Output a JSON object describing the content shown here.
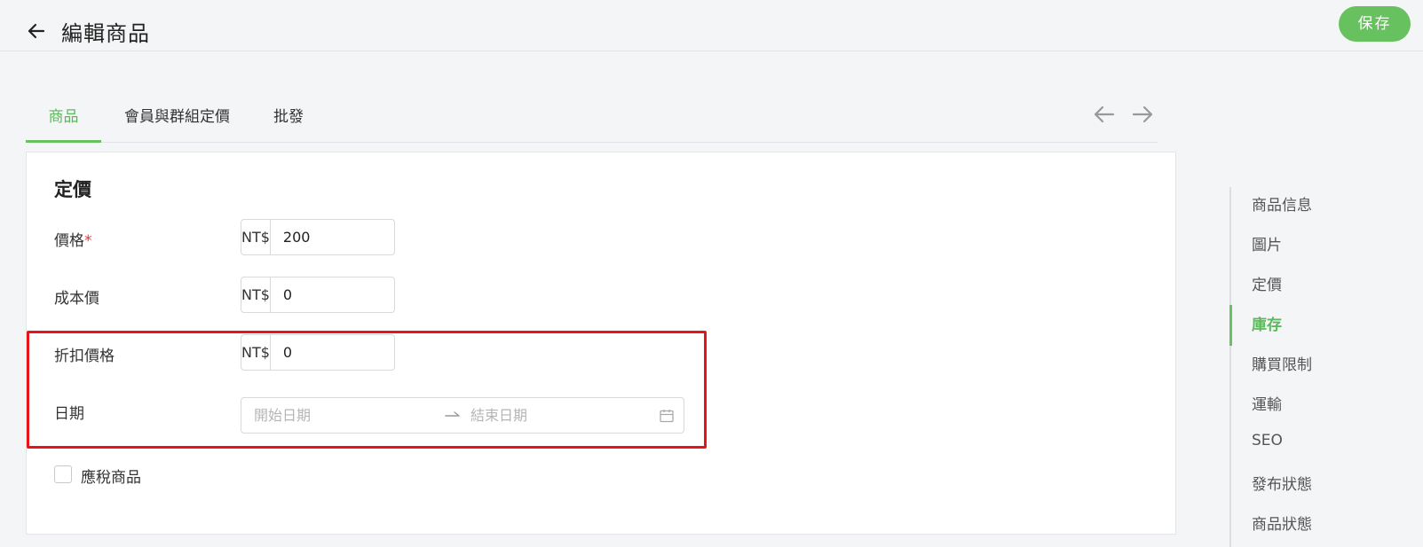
{
  "header": {
    "title": "編輯商品",
    "save_label": "保存"
  },
  "tabs": [
    {
      "label": "商品",
      "active": true
    },
    {
      "label": "會員與群組定價",
      "active": false
    },
    {
      "label": "批發",
      "active": false
    }
  ],
  "pricing": {
    "section_title": "定價",
    "price": {
      "label": "價格",
      "required_mark": "*",
      "currency": "NT$",
      "value": "200"
    },
    "cost": {
      "label": "成本價",
      "currency": "NT$",
      "value": "0"
    },
    "discount": {
      "label": "折扣價格",
      "currency": "NT$",
      "value": "0"
    },
    "date": {
      "label": "日期",
      "start_placeholder": "開始日期",
      "end_placeholder": "結束日期"
    },
    "taxable": {
      "label": "應稅商品",
      "checked": false
    }
  },
  "side_nav": {
    "items": [
      {
        "label": "商品信息",
        "active": false
      },
      {
        "label": "圖片",
        "active": false
      },
      {
        "label": "定價",
        "active": false
      },
      {
        "label": "庫存",
        "active": true
      },
      {
        "label": "購買限制",
        "active": false
      },
      {
        "label": "運輸",
        "active": false
      },
      {
        "label": "SEO",
        "active": false
      },
      {
        "label": "發布狀態",
        "active": false
      },
      {
        "label": "商品狀態",
        "active": false
      }
    ]
  },
  "colors": {
    "accent": "#67c15e",
    "highlight": "#e8141c",
    "background": "#f4f5f7"
  }
}
